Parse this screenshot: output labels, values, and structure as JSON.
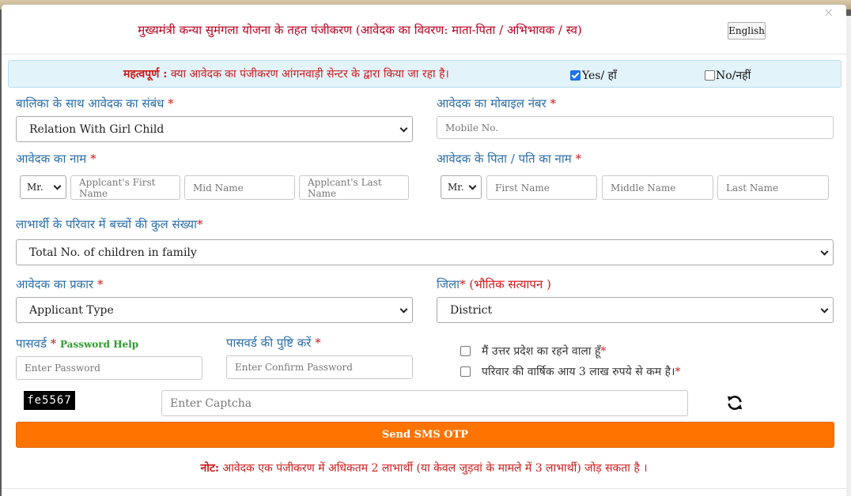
{
  "header": {
    "title": "मुख्यमंत्री कन्या सुमंगला योजना के तहत पंजीकरण (आवेदक का विवरण: माता-पिता / अभिभावक / स्व)",
    "lang_button": "English",
    "close": "×"
  },
  "alert": {
    "prefix": "महत्वपूर्ण :",
    "text": " क्या आवेदक का पंजीकरण आंगनवाड़ी सेन्टर के द्वारा किया जा रहा है।",
    "yes_label": "Yes/ हाँ",
    "no_label": "No/नहीं",
    "yes_checked": true
  },
  "relation": {
    "label": "बालिका के साथ आवेदक का संबंध",
    "req": "*",
    "selected": "Relation With Girl Child"
  },
  "mobile": {
    "label": "आवेदक का मोबाइल नंबर",
    "req": "*",
    "placeholder": "Mobile No."
  },
  "applicant_name": {
    "label": "आवेदक का नाम",
    "req": "*",
    "title": "Mr.",
    "first": "Applcant's First Name",
    "mid": "Mid Name",
    "last": "Applcant's Last Name"
  },
  "father_name": {
    "label": "आवेदक के पिता / पति का नाम",
    "req": "*",
    "title": "Mr.",
    "first": "First Name",
    "mid": "Middle Name",
    "last": "Last Name"
  },
  "children": {
    "label": "लाभार्थी के परिवार में बच्चों की कुल संख्या",
    "req": "*",
    "selected": "Total No. of children in family"
  },
  "applicant_type": {
    "label": "आवेदक का प्रकार",
    "req": "*",
    "selected": "Applicant Type"
  },
  "district": {
    "label": "जिला",
    "req": "*",
    "note": " (भौतिक सत्यापन )",
    "selected": "District"
  },
  "password": {
    "label": "पासवर्ड",
    "req": "*",
    "help": "Password Help",
    "placeholder": "Enter Password"
  },
  "confirm_password": {
    "label": "पासवर्ड की पुष्टि करें",
    "req": "*",
    "placeholder": "Enter Confirm Password"
  },
  "declarations": [
    {
      "text": "मैं उत्तर प्रदेश का रहने वाला हूँ",
      "req": "*"
    },
    {
      "text": "परिवार की वार्षिक आय 3 लाख रुपये से कम है।",
      "req": "*"
    }
  ],
  "captcha": {
    "code": "fe5567",
    "placeholder": "Enter Captcha",
    "refresh_icon": "refresh-icon"
  },
  "otp_button": "Send SMS OTP",
  "note": {
    "prefix": "नोट:",
    "text": " आवेदक एक पंजीकरण में अधिकतम 2 लाभार्थी (या केवल जुड़वां के मामले में 3 लाभार्थी) जोड़ सकता है ।"
  }
}
